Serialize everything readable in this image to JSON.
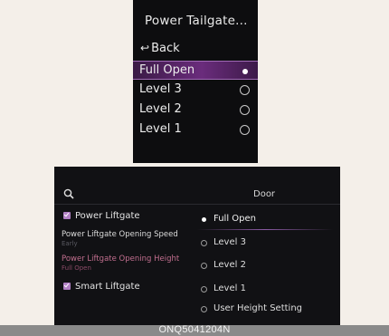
{
  "cluster_menu": {
    "title": "Power Tailgate...",
    "back_label": "Back",
    "options": [
      {
        "label": "Full Open",
        "selected": true
      },
      {
        "label": "Level 3",
        "selected": false
      },
      {
        "label": "Level 2",
        "selected": false
      },
      {
        "label": "Level 1",
        "selected": false
      }
    ]
  },
  "door_settings": {
    "title": "Door",
    "power_liftgate": {
      "label": "Power Liftgate",
      "checked": true
    },
    "opening_speed": {
      "label": "Power Liftgate Opening Speed",
      "value": "Early"
    },
    "opening_height": {
      "label": "Power Liftgate Opening Height",
      "value": "Full Open"
    },
    "smart_liftgate": {
      "label": "Smart Liftgate",
      "checked": true
    },
    "height_options": [
      {
        "label": "Full Open",
        "selected": true
      },
      {
        "label": "Level 3",
        "selected": false
      },
      {
        "label": "Level 2",
        "selected": false
      },
      {
        "label": "Level 1",
        "selected": false
      },
      {
        "label": "User Height Setting",
        "selected": false
      }
    ]
  },
  "caption": "ONQ5041204N",
  "colors": {
    "accent_purple": "#7a3a8e",
    "highlight_text": "#c07090",
    "muted_text": "#5e5e66",
    "panel_bg": "#111114",
    "page_bg": "#f4efe9"
  },
  "icons": {
    "back": "back-arrow-icon",
    "search": "search-icon",
    "checkbox": "checkbox-checked-icon",
    "radio": "radio-button-icon"
  }
}
